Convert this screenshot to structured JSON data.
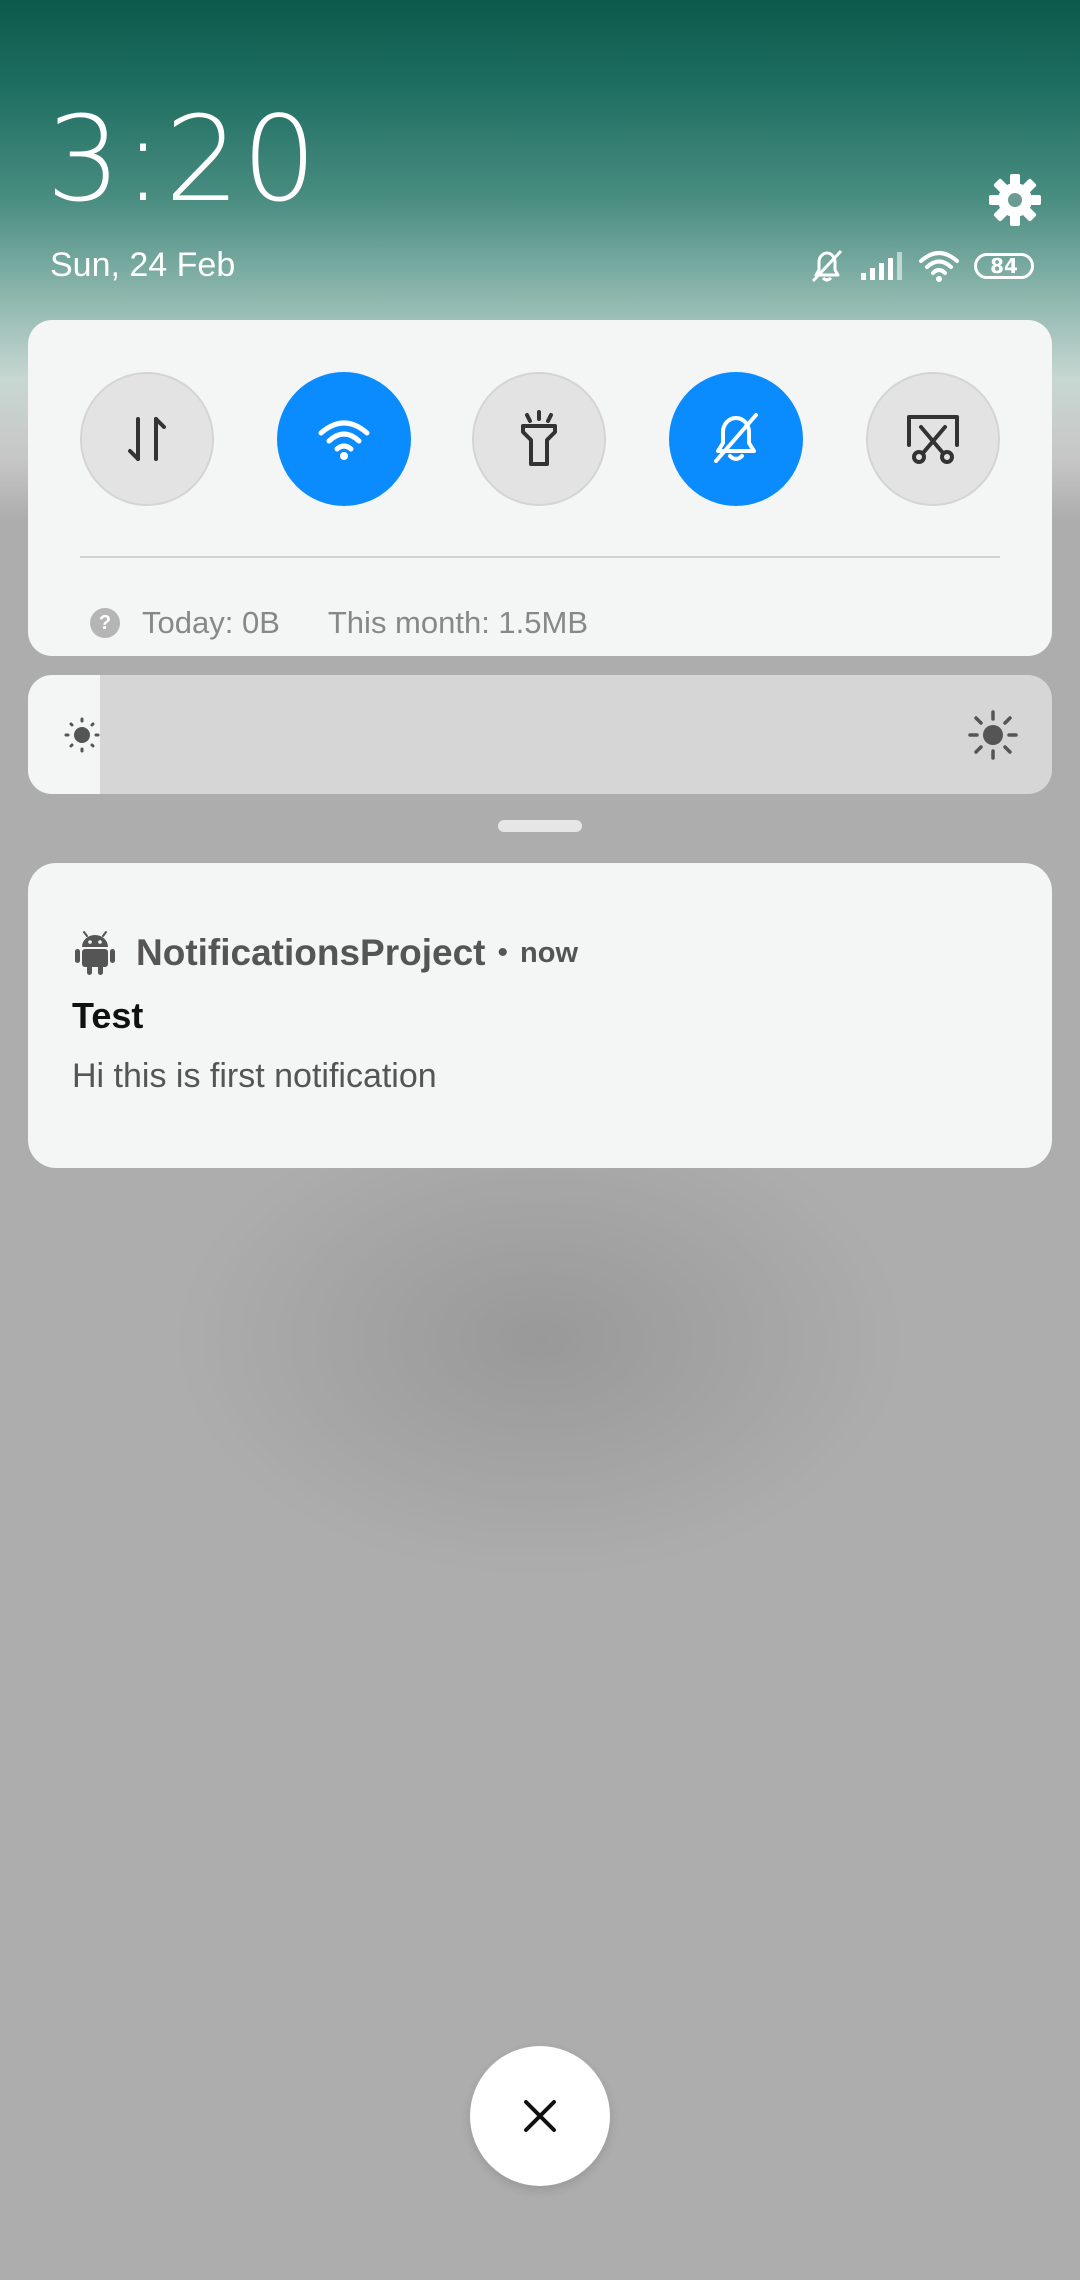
{
  "header": {
    "time": "3:20",
    "date": "Sun, 24 Feb",
    "battery_level": "84",
    "icons": [
      "gear-icon",
      "bell-off-icon",
      "signal-icon",
      "wifi-icon",
      "battery-icon"
    ]
  },
  "quick_settings": {
    "tiles": [
      {
        "name": "mobile-data",
        "icon": "arrows-updown-icon",
        "active": false
      },
      {
        "name": "wifi",
        "icon": "wifi-icon",
        "active": true
      },
      {
        "name": "flashlight",
        "icon": "flashlight-icon",
        "active": false
      },
      {
        "name": "silent",
        "icon": "bell-off-icon",
        "active": true
      },
      {
        "name": "screenshot",
        "icon": "scissors-icon",
        "active": false
      }
    ],
    "data_usage": {
      "help_glyph": "?",
      "today": "Today: 0B",
      "month": "This month: 1.5MB"
    }
  },
  "brightness": {
    "level": 0.07
  },
  "notification": {
    "app_name": "NotificationsProject",
    "separator": "•",
    "time": "now",
    "title": "Test",
    "body": "Hi this is first notification"
  },
  "colors": {
    "accent": "#0a8cff",
    "panel": "#f4f5f5",
    "backdrop": "#adadad"
  }
}
